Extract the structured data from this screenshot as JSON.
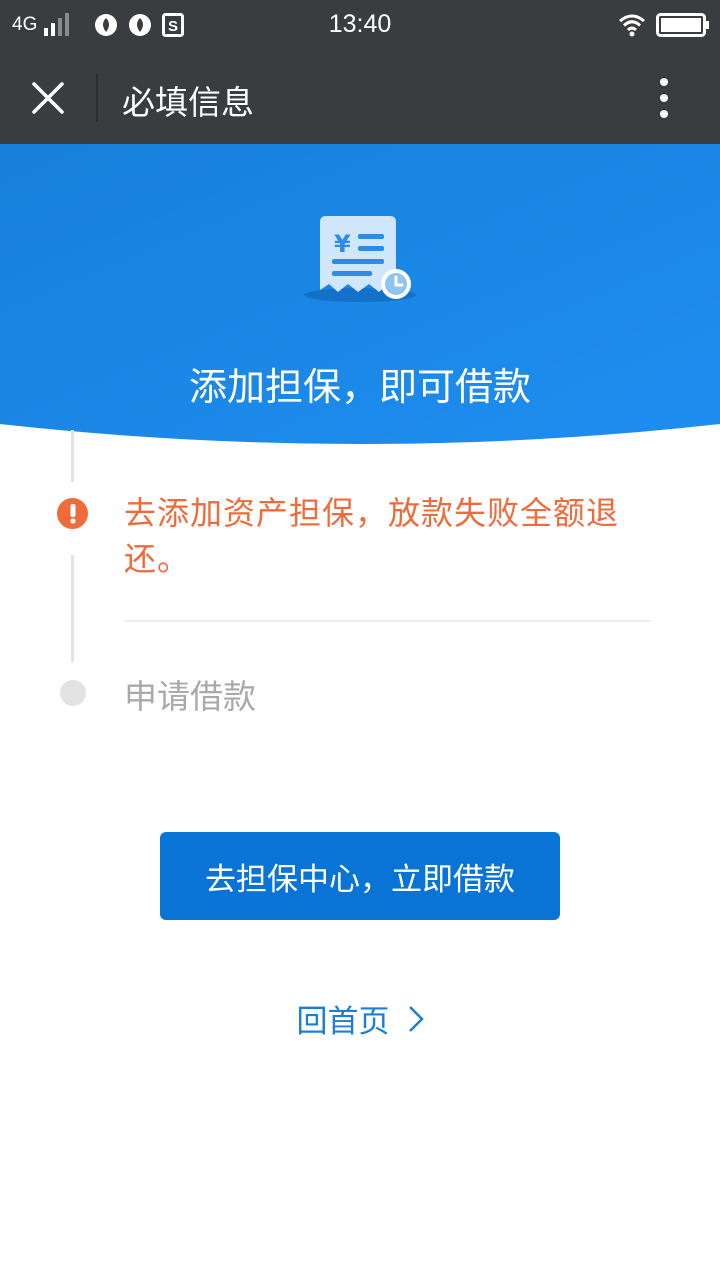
{
  "status_bar": {
    "network": "4G",
    "time": "13:40",
    "icons": [
      "signal-icon",
      "app-notification-icon",
      "app-notification-icon",
      "sim-s-icon",
      "wifi-icon",
      "battery-icon"
    ]
  },
  "title_bar": {
    "title": "必填信息",
    "close_icon": "close-icon",
    "more_icon": "more-vertical-icon"
  },
  "hero": {
    "title": "添加担保，即可借款",
    "icon": "receipt-yen-clock-icon",
    "gradient": [
      "#1a84de",
      "#1e8ef0"
    ]
  },
  "steps": [
    {
      "status": "warning",
      "text": "去添加资产担保，放款失败全额退还。",
      "color": "#ef6b3b",
      "icon": "exclamation-icon"
    },
    {
      "status": "pending",
      "text": "申请借款",
      "color": "#a9a9a9"
    }
  ],
  "primary_button": {
    "label": "去担保中心，立即借款",
    "color": "#0a74d6"
  },
  "home_link": {
    "label": "回首页",
    "icon": "chevron-right-icon",
    "color": "#1a7fd4"
  }
}
